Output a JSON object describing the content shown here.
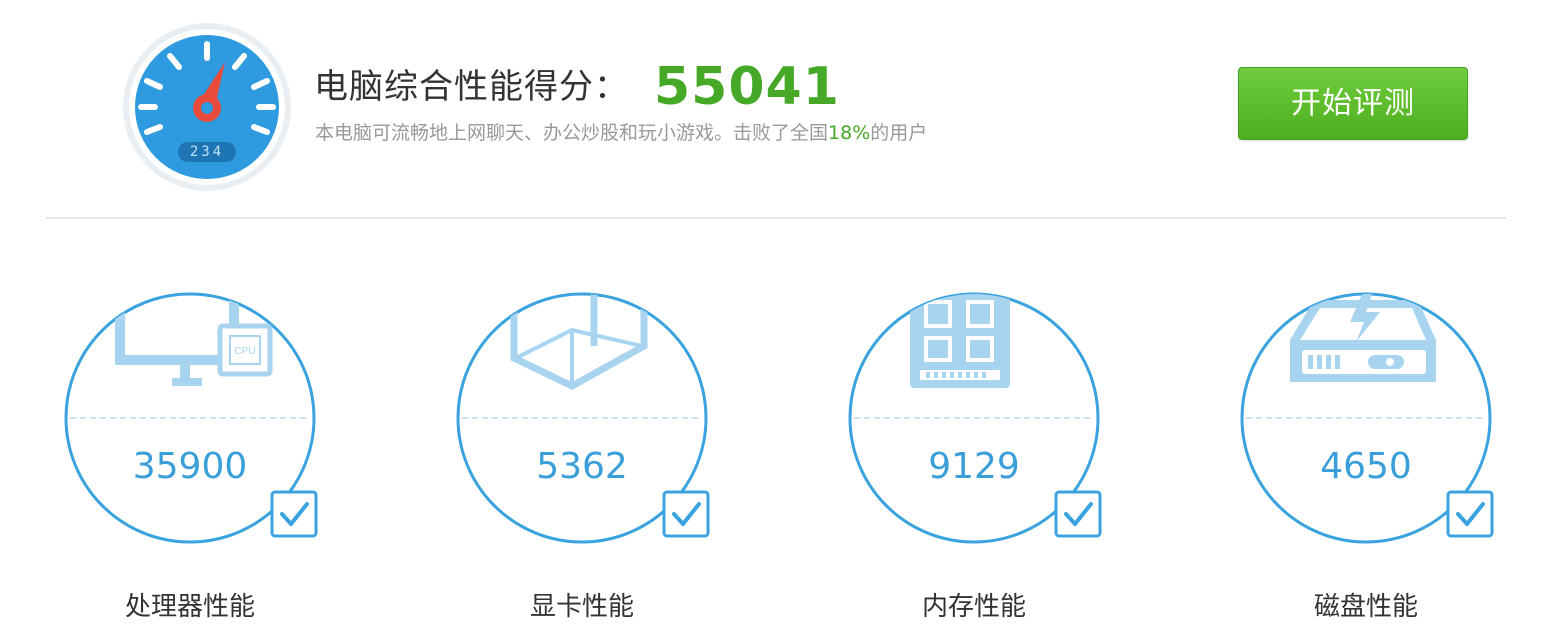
{
  "header": {
    "title": "电脑综合性能得分：",
    "score": "55041",
    "description_prefix": "本电脑可流畅地上网聊天、办公炒股和玩小游戏。击败了全国",
    "percent": "18%",
    "description_suffix": "的用户",
    "gauge_readout": "234",
    "start_button_label": "开始评测"
  },
  "colors": {
    "accent_green": "#45a826",
    "accent_blue": "#3a9fd9",
    "gauge_blue": "#2e9be0"
  },
  "cards": [
    {
      "icon": "cpu-monitor-icon",
      "value": "35900",
      "label": "处理器性能",
      "checked": true
    },
    {
      "icon": "graphics-card-icon",
      "value": "5362",
      "label": "显卡性能",
      "checked": true
    },
    {
      "icon": "memory-icon",
      "value": "9129",
      "label": "内存性能",
      "checked": true
    },
    {
      "icon": "disk-icon",
      "value": "4650",
      "label": "磁盘性能",
      "checked": true
    }
  ]
}
